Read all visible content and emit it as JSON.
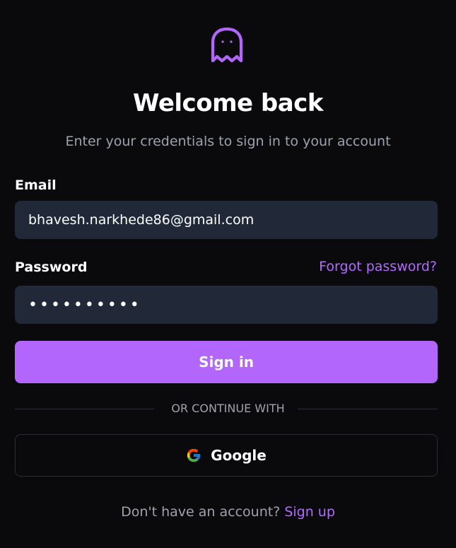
{
  "brand": {
    "icon": "ghost-icon",
    "accent_color": "#b366fc"
  },
  "header": {
    "title": "Welcome back",
    "subtitle": "Enter your credentials to sign in to your account"
  },
  "form": {
    "email": {
      "label": "Email",
      "value": "bhavesh.narkhede86@gmail.com"
    },
    "password": {
      "label": "Password",
      "value_masked": "••••••••••",
      "forgot_label": "Forgot password?"
    },
    "submit_label": "Sign in"
  },
  "divider": {
    "text": "OR CONTINUE WITH"
  },
  "social": {
    "google_label": "Google",
    "icon": "google-icon"
  },
  "footer": {
    "prompt": "Don't have an account?",
    "signup_label": "Sign up"
  },
  "colors": {
    "background": "#0a0a0c",
    "input_background": "#212838",
    "link": "#b26aff",
    "muted_text": "#9ca3af"
  }
}
